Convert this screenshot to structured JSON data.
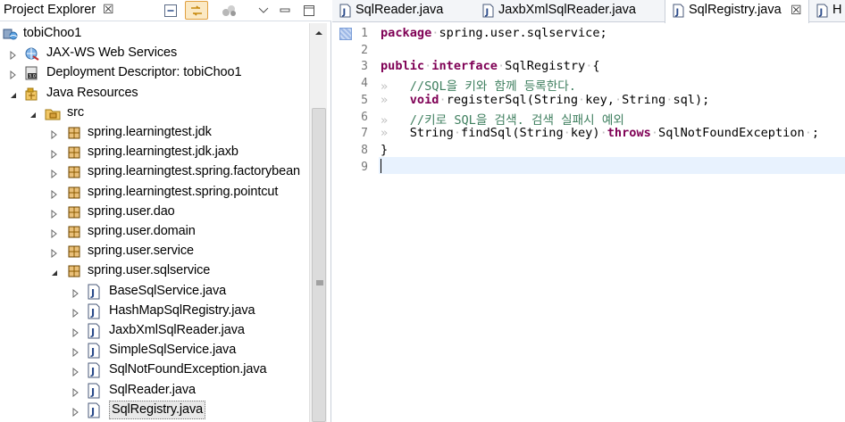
{
  "explorer": {
    "title": "Project Explorer",
    "close_glyph": "☒",
    "toolbar": {
      "collapse_icon": "collapse-all-icon",
      "link_icon": "link-with-editor-icon",
      "filter_icon": "filter-icon",
      "menu_icon": "view-menu-icon",
      "minimize_icon": "minimize-icon",
      "maximize_icon": "maximize-icon"
    },
    "tree": [
      {
        "label": "tobiChoo1",
        "icon": "web-project-icon",
        "depth": 0,
        "arrow": "none"
      },
      {
        "label": "JAX-WS Web Services",
        "icon": "web-services-icon",
        "depth": 1,
        "arrow": "collapsed"
      },
      {
        "label": "Deployment Descriptor: tobiChoo1",
        "icon": "deployment-descriptor-icon",
        "depth": 1,
        "arrow": "collapsed"
      },
      {
        "label": "Java Resources",
        "icon": "java-resources-icon",
        "depth": 1,
        "arrow": "expanded"
      },
      {
        "label": "src",
        "icon": "source-folder-icon",
        "depth": 2,
        "arrow": "expanded"
      },
      {
        "label": "spring.learningtest.jdk",
        "icon": "package-icon",
        "depth": 3,
        "arrow": "collapsed"
      },
      {
        "label": "spring.learningtest.jdk.jaxb",
        "icon": "package-icon",
        "depth": 3,
        "arrow": "collapsed"
      },
      {
        "label": "spring.learningtest.spring.factorybean",
        "icon": "package-icon",
        "depth": 3,
        "arrow": "collapsed"
      },
      {
        "label": "spring.learningtest.spring.pointcut",
        "icon": "package-icon",
        "depth": 3,
        "arrow": "collapsed"
      },
      {
        "label": "spring.user.dao",
        "icon": "package-icon",
        "depth": 3,
        "arrow": "collapsed"
      },
      {
        "label": "spring.user.domain",
        "icon": "package-icon",
        "depth": 3,
        "arrow": "collapsed"
      },
      {
        "label": "spring.user.service",
        "icon": "package-icon",
        "depth": 3,
        "arrow": "collapsed"
      },
      {
        "label": "spring.user.sqlservice",
        "icon": "package-icon",
        "depth": 3,
        "arrow": "expanded"
      },
      {
        "label": "BaseSqlService.java",
        "icon": "java-file-icon",
        "depth": 4,
        "arrow": "collapsed"
      },
      {
        "label": "HashMapSqlRegistry.java",
        "icon": "java-file-icon",
        "depth": 4,
        "arrow": "collapsed"
      },
      {
        "label": "JaxbXmlSqlReader.java",
        "icon": "java-file-icon",
        "depth": 4,
        "arrow": "collapsed"
      },
      {
        "label": "SimpleSqlService.java",
        "icon": "java-file-icon",
        "depth": 4,
        "arrow": "collapsed"
      },
      {
        "label": "SqlNotFoundException.java",
        "icon": "java-file-icon",
        "depth": 4,
        "arrow": "collapsed"
      },
      {
        "label": "SqlReader.java",
        "icon": "java-file-icon",
        "depth": 4,
        "arrow": "collapsed"
      },
      {
        "label": "SqlRegistry.java",
        "icon": "java-file-icon",
        "depth": 4,
        "arrow": "collapsed",
        "selected": true
      }
    ]
  },
  "editor": {
    "tabs": [
      {
        "label": "SqlReader.java",
        "active": false
      },
      {
        "label": "JaxbXmlSqlReader.java",
        "active": false
      },
      {
        "label": "SqlRegistry.java",
        "active": true,
        "close_glyph": "☒"
      },
      {
        "label": "H",
        "active": false
      }
    ],
    "line_numbers": [
      "1",
      "2",
      "3",
      "4",
      "5",
      "6",
      "7",
      "8",
      "9"
    ],
    "current_line": 9,
    "code": [
      [
        {
          "t": "kw",
          "v": "package"
        },
        {
          "t": "ws",
          "v": "·"
        },
        {
          "t": "",
          "v": "spring.user.sqlservice;"
        }
      ],
      [],
      [
        {
          "t": "kw",
          "v": "public"
        },
        {
          "t": "ws",
          "v": "·"
        },
        {
          "t": "kw",
          "v": "interface"
        },
        {
          "t": "ws",
          "v": "·"
        },
        {
          "t": "",
          "v": "SqlRegistry"
        },
        {
          "t": "ws",
          "v": "·"
        },
        {
          "t": "",
          "v": "{"
        }
      ],
      [
        {
          "t": "ws",
          "v": "»   "
        },
        {
          "t": "cm",
          "v": "//SQL을 키와 함께 등록한다."
        }
      ],
      [
        {
          "t": "ws",
          "v": "»   "
        },
        {
          "t": "kw",
          "v": "void"
        },
        {
          "t": "ws",
          "v": "·"
        },
        {
          "t": "",
          "v": "registerSql(String"
        },
        {
          "t": "ws",
          "v": "·"
        },
        {
          "t": "",
          "v": "key,"
        },
        {
          "t": "ws",
          "v": "·"
        },
        {
          "t": "",
          "v": "String"
        },
        {
          "t": "ws",
          "v": "·"
        },
        {
          "t": "",
          "v": "sql);"
        }
      ],
      [
        {
          "t": "ws",
          "v": "»   "
        },
        {
          "t": "cm",
          "v": "//키로 SQL을 검색. 검색 실패시 예외"
        }
      ],
      [
        {
          "t": "ws",
          "v": "»   "
        },
        {
          "t": "",
          "v": "String"
        },
        {
          "t": "ws",
          "v": "·"
        },
        {
          "t": "",
          "v": "findSql(String"
        },
        {
          "t": "ws",
          "v": "·"
        },
        {
          "t": "",
          "v": "key)"
        },
        {
          "t": "ws",
          "v": "·"
        },
        {
          "t": "kw",
          "v": "throws"
        },
        {
          "t": "ws",
          "v": "·"
        },
        {
          "t": "",
          "v": "SqlNotFoundException"
        },
        {
          "t": "ws",
          "v": "·"
        },
        {
          "t": "",
          "v": ";"
        }
      ],
      [
        {
          "t": "",
          "v": "}"
        }
      ],
      []
    ]
  }
}
